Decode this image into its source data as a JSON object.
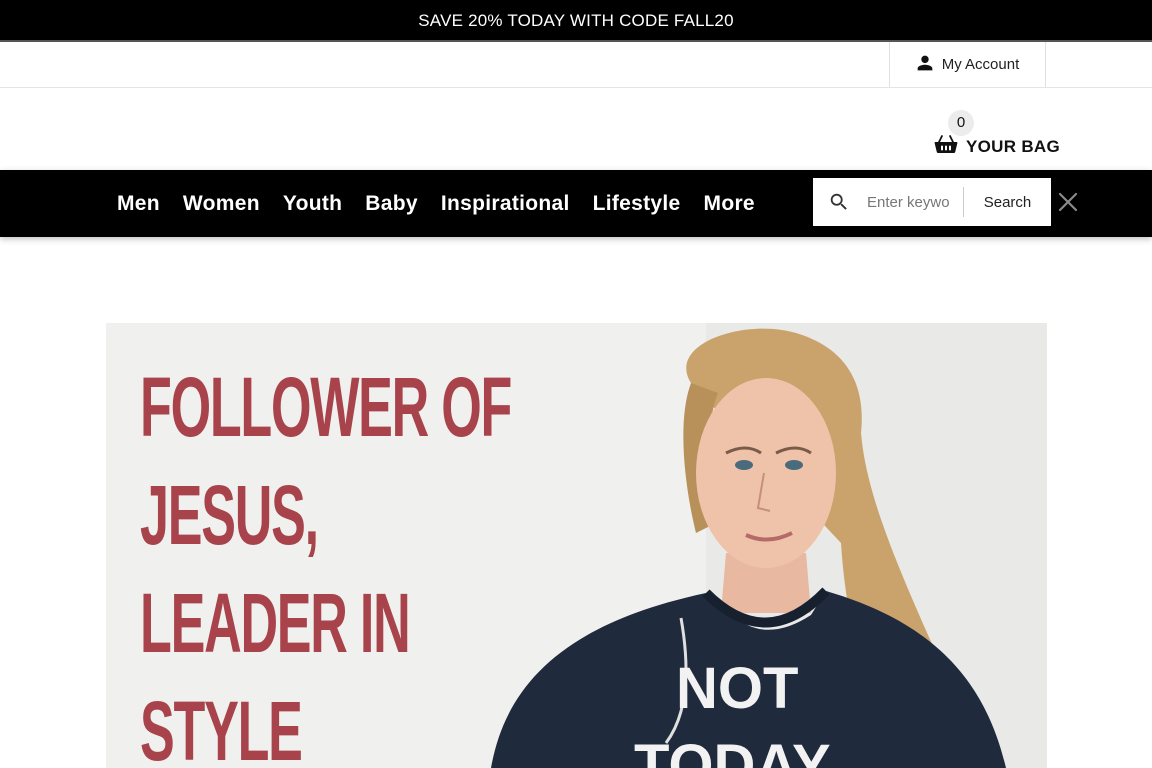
{
  "promo_banner": {
    "text": "SAVE 20% TODAY WITH CODE FALL20"
  },
  "account": {
    "label": "My Account",
    "icon": "person-icon"
  },
  "bag": {
    "count": "0",
    "label": "YOUR BAG",
    "icon": "shopping-basket-icon"
  },
  "nav": {
    "items": [
      {
        "label": "Men"
      },
      {
        "label": "Women"
      },
      {
        "label": "Youth"
      },
      {
        "label": "Baby"
      },
      {
        "label": "Inspirational"
      },
      {
        "label": "Lifestyle"
      },
      {
        "label": "More"
      }
    ]
  },
  "search": {
    "placeholder": "Enter keywo",
    "button_label": "Search",
    "icon": "search-icon",
    "close_icon": "close-icon"
  },
  "hero": {
    "headline_lines": [
      "FOLLOWER OF",
      "JESUS,",
      "LEADER IN",
      "STYLE"
    ],
    "shirt_text_lines": [
      "NOT",
      "TODAY"
    ]
  },
  "colors": {
    "promo_bg": "#000000",
    "nav_bg": "#000000",
    "hero_text": "#a8434b",
    "sweatshirt": "#1f2a3d"
  }
}
